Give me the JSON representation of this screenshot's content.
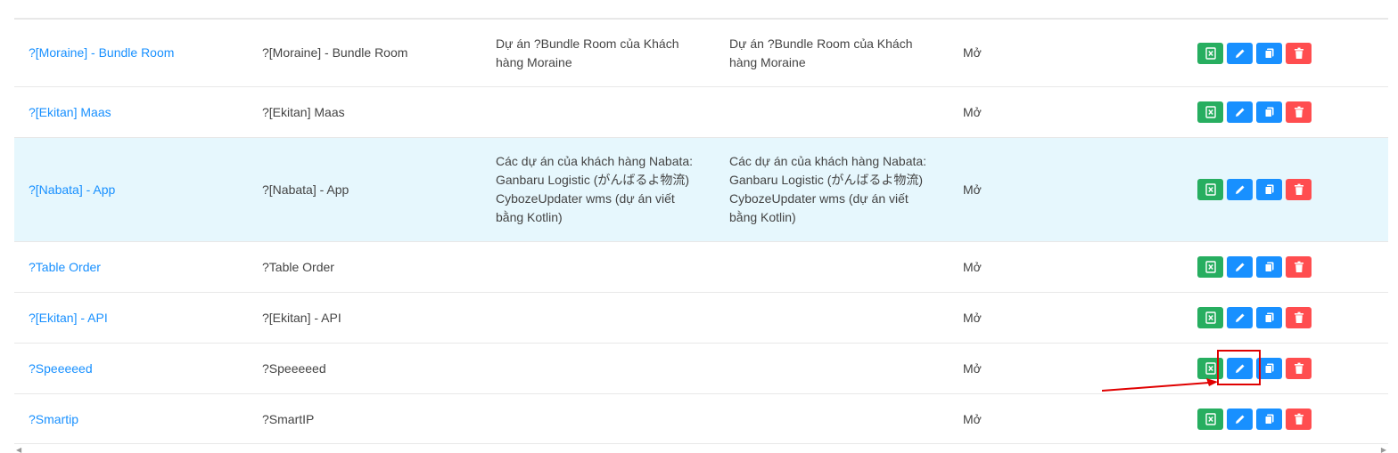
{
  "rows": [
    {
      "name": "?[Moraine] - Bundle Room",
      "code": "?[Moraine] - Bundle Room",
      "desc": "Dự án ?Bundle Room của Khách hàng Moraine",
      "note": "Dự án ?Bundle Room của Khách hàng Moraine",
      "status": "Mở"
    },
    {
      "name": "?[Ekitan] Maas",
      "code": "?[Ekitan] Maas",
      "desc": "",
      "note": "",
      "status": "Mở"
    },
    {
      "name": "?[Nabata] - App",
      "code": "?[Nabata] - App",
      "desc": "Các dự án của khách hàng Nabata: Ganbaru Logistic (がんばるよ物流) CybozeUpdater wms (dự án viết bằng Kotlin)",
      "note": "Các dự án của khách hàng Nabata: Ganbaru Logistic (がんばるよ物流) CybozeUpdater wms (dự án viết bằng Kotlin)",
      "status": "Mở"
    },
    {
      "name": "?Table Order",
      "code": "?Table Order",
      "desc": "",
      "note": "",
      "status": "Mở"
    },
    {
      "name": "?[Ekitan] - API",
      "code": "?[Ekitan] - API",
      "desc": "",
      "note": "",
      "status": "Mở"
    },
    {
      "name": "?Speeeeed",
      "code": "?Speeeeed",
      "desc": "",
      "note": "",
      "status": "Mở"
    },
    {
      "name": "?Smartip",
      "code": "?SmartIP",
      "desc": "",
      "note": "",
      "status": "Mở"
    }
  ],
  "colors": {
    "export": "#27ae60",
    "edit": "#1890ff",
    "copy": "#1890ff",
    "delete": "#ff4d4f",
    "link": "#1890ff",
    "highlight_row": "#e6f7fd",
    "annotation": "#e00000"
  },
  "icons": {
    "export": "excel-icon",
    "edit": "pencil-icon",
    "copy": "copy-icon",
    "delete": "trash-icon"
  },
  "highlighted_row": 2,
  "annotated_button": "edit button on row ?Speeeeed"
}
